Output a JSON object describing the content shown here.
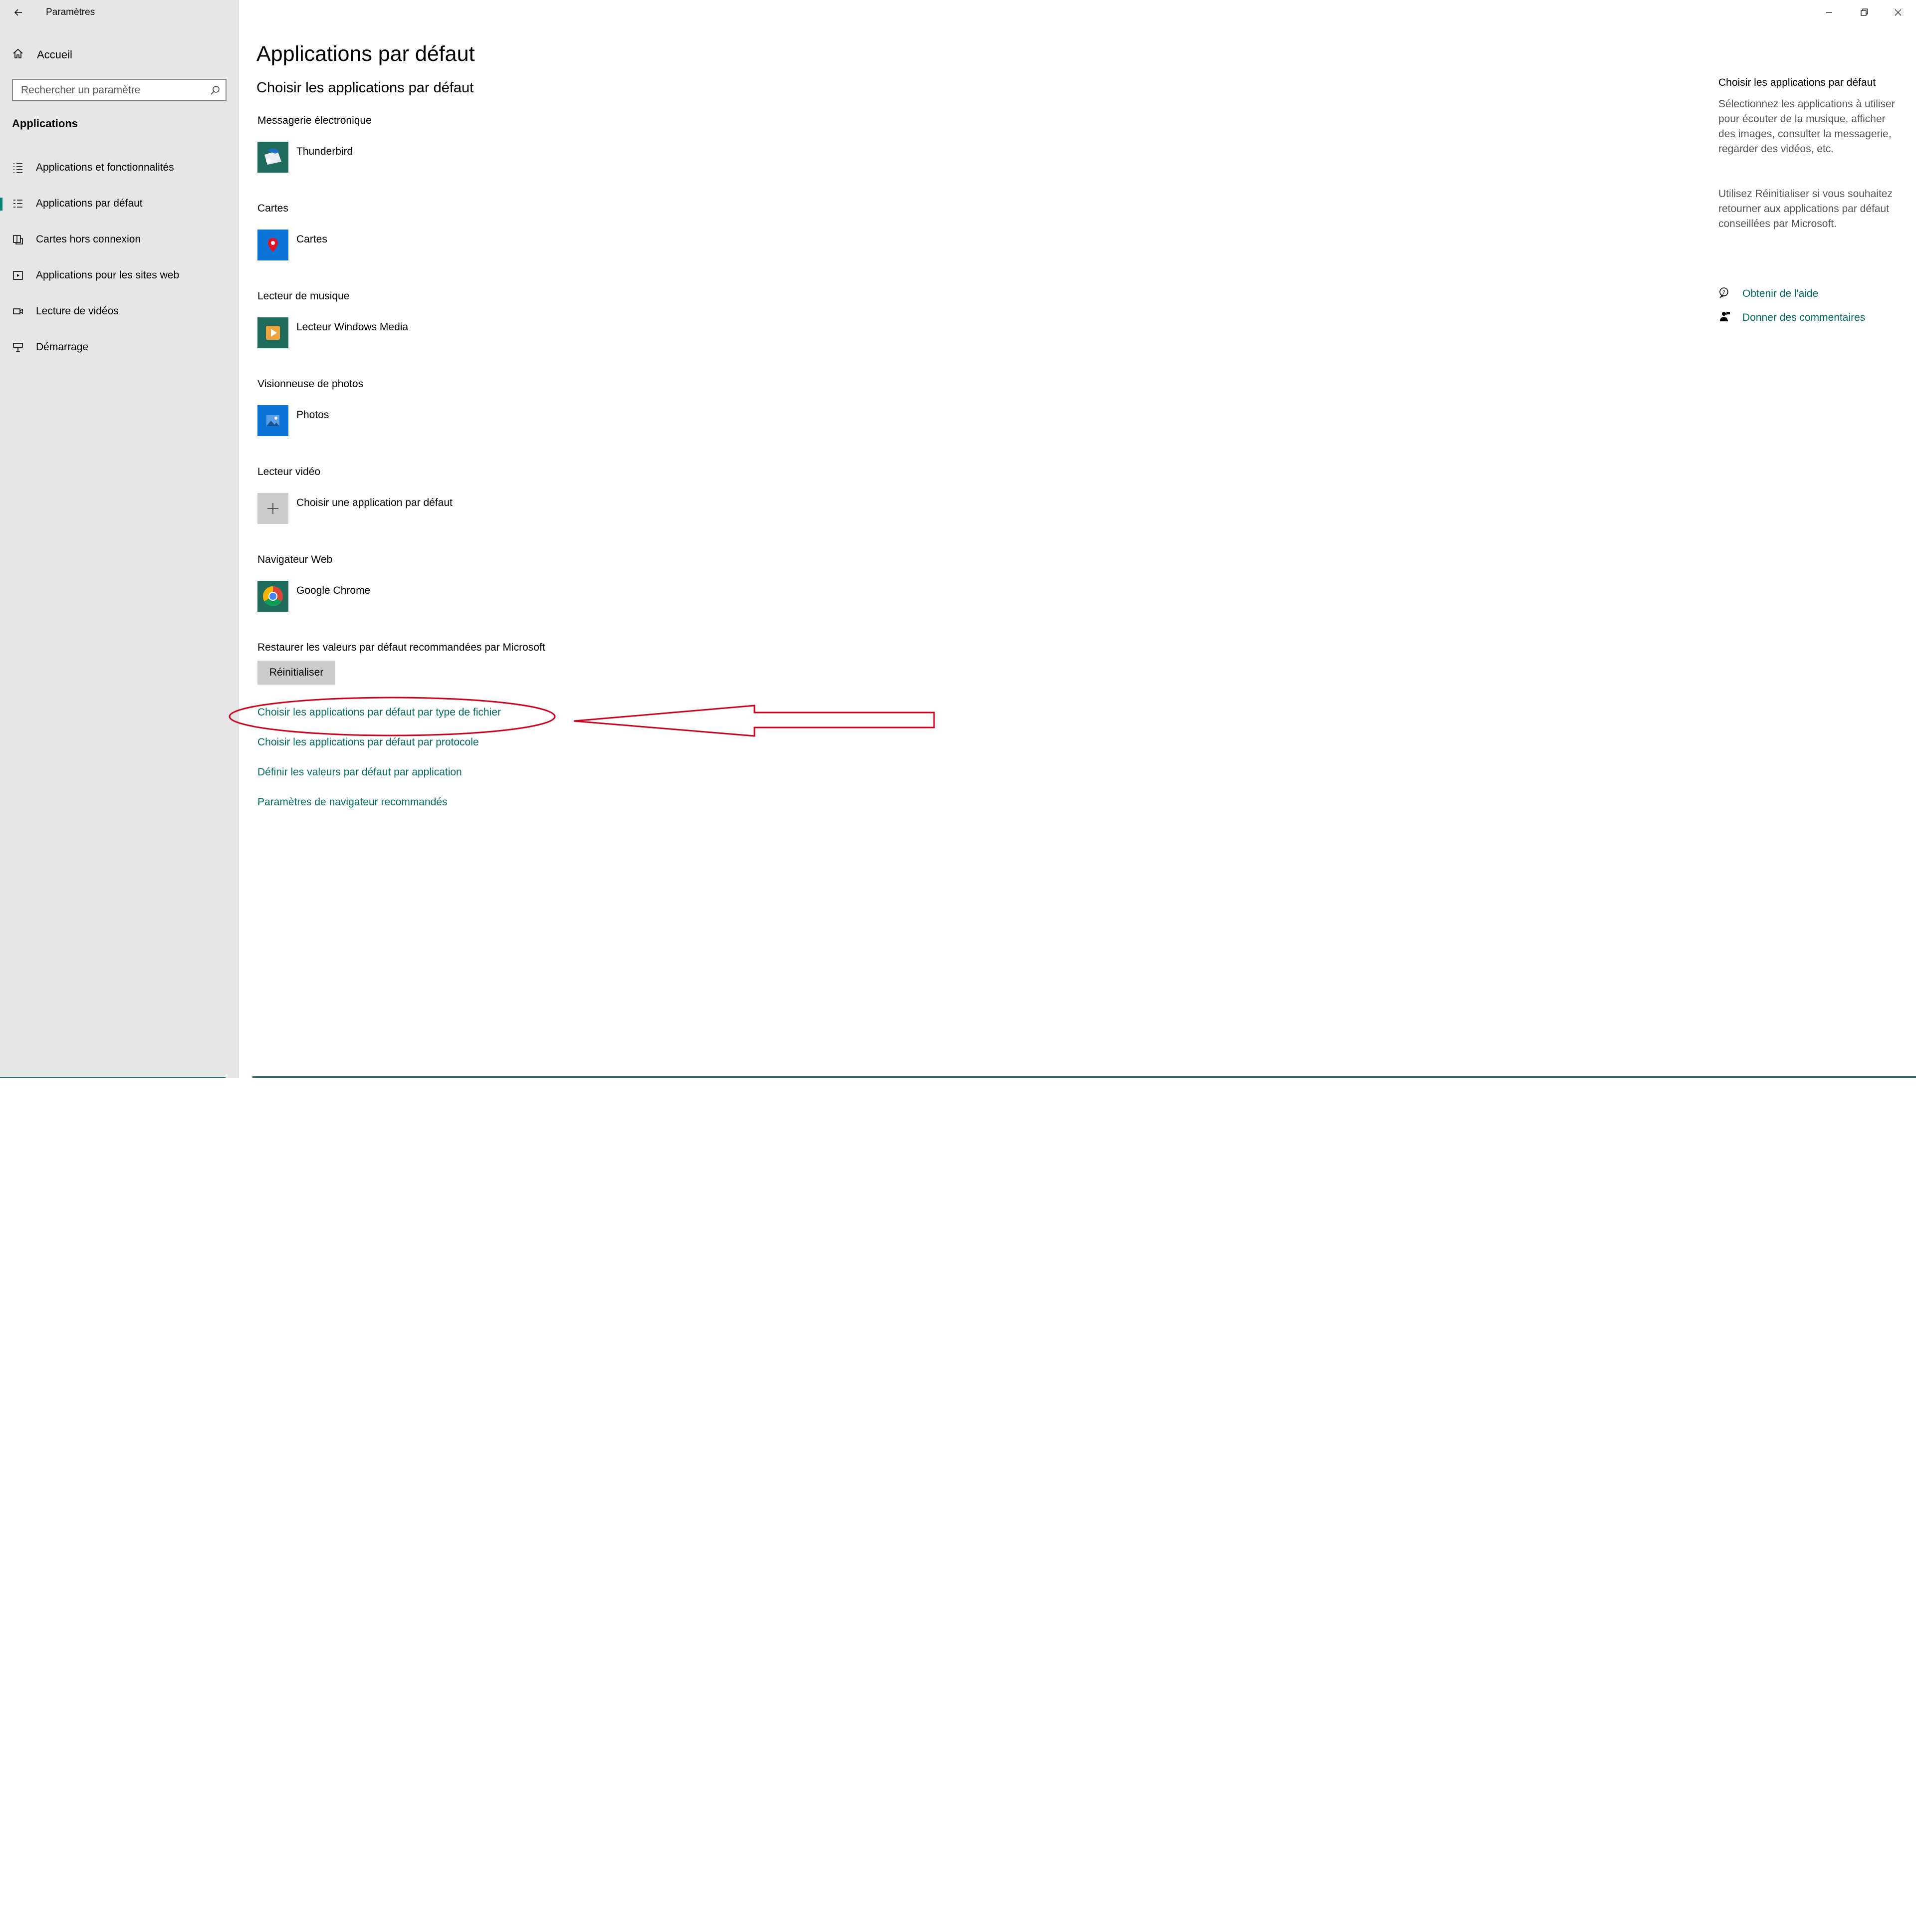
{
  "window": {
    "title": "Paramètres"
  },
  "sidebar": {
    "home_label": "Accueil",
    "search_placeholder": "Rechercher un paramètre",
    "section_title": "Applications",
    "items": [
      {
        "label": "Applications et fonctionnalités",
        "icon": "list-icon"
      },
      {
        "label": "Applications par défaut",
        "icon": "default-apps-icon",
        "selected": true
      },
      {
        "label": "Cartes hors connexion",
        "icon": "offline-maps-icon"
      },
      {
        "label": "Applications pour les sites web",
        "icon": "web-apps-icon"
      },
      {
        "label": "Lecture de vidéos",
        "icon": "video-icon"
      },
      {
        "label": "Démarrage",
        "icon": "startup-icon"
      }
    ]
  },
  "main": {
    "title": "Applications par défaut",
    "subtitle": "Choisir les applications par défaut",
    "categories": [
      {
        "label": "Messagerie électronique",
        "app": "Thunderbird",
        "icon": "thunderbird-icon"
      },
      {
        "label": "Cartes",
        "app": "Cartes",
        "icon": "maps-app-icon"
      },
      {
        "label": "Lecteur de musique",
        "app": "Lecteur Windows Media",
        "icon": "windows-media-player-icon"
      },
      {
        "label": "Visionneuse de photos",
        "app": "Photos",
        "icon": "photos-app-icon"
      },
      {
        "label": "Lecteur vidéo",
        "app": "Choisir une application par défaut",
        "icon": "plus-icon"
      },
      {
        "label": "Navigateur Web",
        "app": "Google Chrome",
        "icon": "chrome-icon"
      }
    ],
    "reset_label": "Restaurer les valeurs par défaut recommandées par Microsoft",
    "reset_button": "Réinitialiser",
    "links": [
      "Choisir les applications par défaut par type de fichier",
      "Choisir les applications par défaut par protocole",
      "Définir les valeurs par défaut par application",
      "Paramètres de navigateur recommandés"
    ]
  },
  "right_panel": {
    "title": "Choisir les applications par défaut",
    "description_1": "Sélectionnez les applications à utiliser pour écouter de la musique, afficher des images, consulter la messagerie, regarder des vidéos, etc.",
    "description_2": "Utilisez Réinitialiser si vous souhaitez retourner aux applications par défaut conseillées par Microsoft.",
    "help_link": "Obtenir de l'aide",
    "feedback_link": "Donner des commentaires"
  },
  "colors": {
    "sidebar_bg": "#e6e6e6",
    "accent": "#008575",
    "link": "#006a5f",
    "annotation": "#d0021b"
  }
}
